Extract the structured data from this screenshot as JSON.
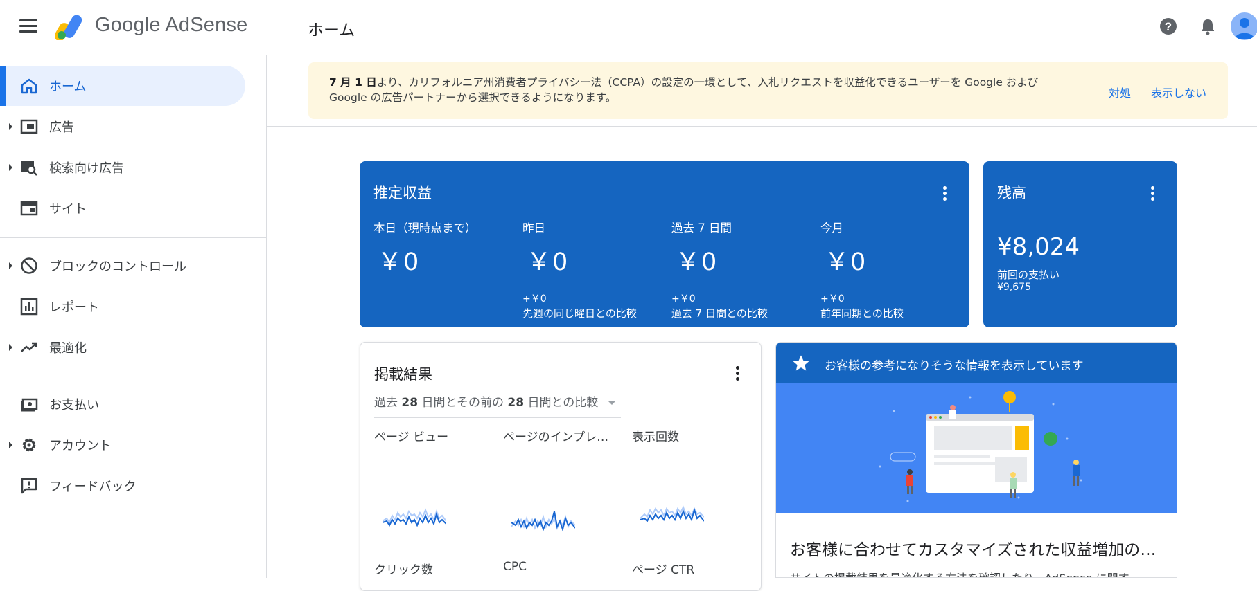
{
  "app": {
    "brand": "Google AdSense",
    "page_title": "ホーム"
  },
  "sidebar": {
    "items": [
      {
        "label": "ホーム",
        "icon": "home-icon",
        "active": true
      },
      {
        "label": "広告",
        "icon": "ads-icon",
        "expandable": true
      },
      {
        "label": "検索向け広告",
        "icon": "search-ads-icon",
        "expandable": true
      },
      {
        "label": "サイト",
        "icon": "sites-icon"
      },
      {
        "label": "ブロックのコントロール",
        "icon": "block-icon",
        "expandable": true
      },
      {
        "label": "レポート",
        "icon": "report-icon"
      },
      {
        "label": "最適化",
        "icon": "trending-icon",
        "expandable": true
      },
      {
        "label": "お支払い",
        "icon": "payments-icon"
      },
      {
        "label": "アカウント",
        "icon": "gear-icon",
        "expandable": true
      },
      {
        "label": "フィードバック",
        "icon": "feedback-icon"
      }
    ]
  },
  "banner": {
    "bold": "7 月 1 日",
    "text_line1": "より、カリフォルニア州消費者プライバシー法（CCPA）の設定の一環として、入札リクエストを収益化できるユーザーを Google および",
    "text_line2": "Google の広告パートナーから選択できるようになります。",
    "action_fix": "対処",
    "action_dismiss": "表示しない"
  },
  "earnings": {
    "title": "推定収益",
    "metrics": [
      {
        "label": "本日（現時点まで）",
        "value": "￥0",
        "delta": "",
        "compare": ""
      },
      {
        "label": "昨日",
        "value": "￥0",
        "delta": "+￥0",
        "compare": "先週の同じ曜日との比較"
      },
      {
        "label": "過去 7 日間",
        "value": "￥0",
        "delta": "+￥0",
        "compare": "過去 7 日間との比較"
      },
      {
        "label": "今月",
        "value": "￥0",
        "delta": "+￥0",
        "compare": "前年同期との比較"
      }
    ]
  },
  "balance": {
    "title": "残高",
    "value": "¥8,024",
    "last_payment_label": "前回の支払い",
    "last_payment_value": "¥9,675"
  },
  "performance": {
    "title": "掲載結果",
    "range_prefix": "過去",
    "range_n1": "28",
    "range_mid": "日間とその前の",
    "range_n2": "28",
    "range_suffix": "日間との比較",
    "metrics_top": [
      "ページ ビュー",
      "ページのインプレッション",
      "表示回数"
    ],
    "metrics_bottom": [
      "クリック数",
      "CPC",
      "ページ CTR"
    ]
  },
  "tips": {
    "header": "お客様の参考になりそうな情報を表示しています",
    "title": "お客様に合わせてカスタマイズされた収益増加のヒント",
    "body": "サイトの掲載結果を最適化する方法を確認したり、AdSense に関す"
  },
  "colors": {
    "primary_blue": "#1565c0",
    "accent_blue": "#1a73e8",
    "banner_bg": "#fef7e0",
    "active_nav_bg": "#e8f0fe"
  }
}
